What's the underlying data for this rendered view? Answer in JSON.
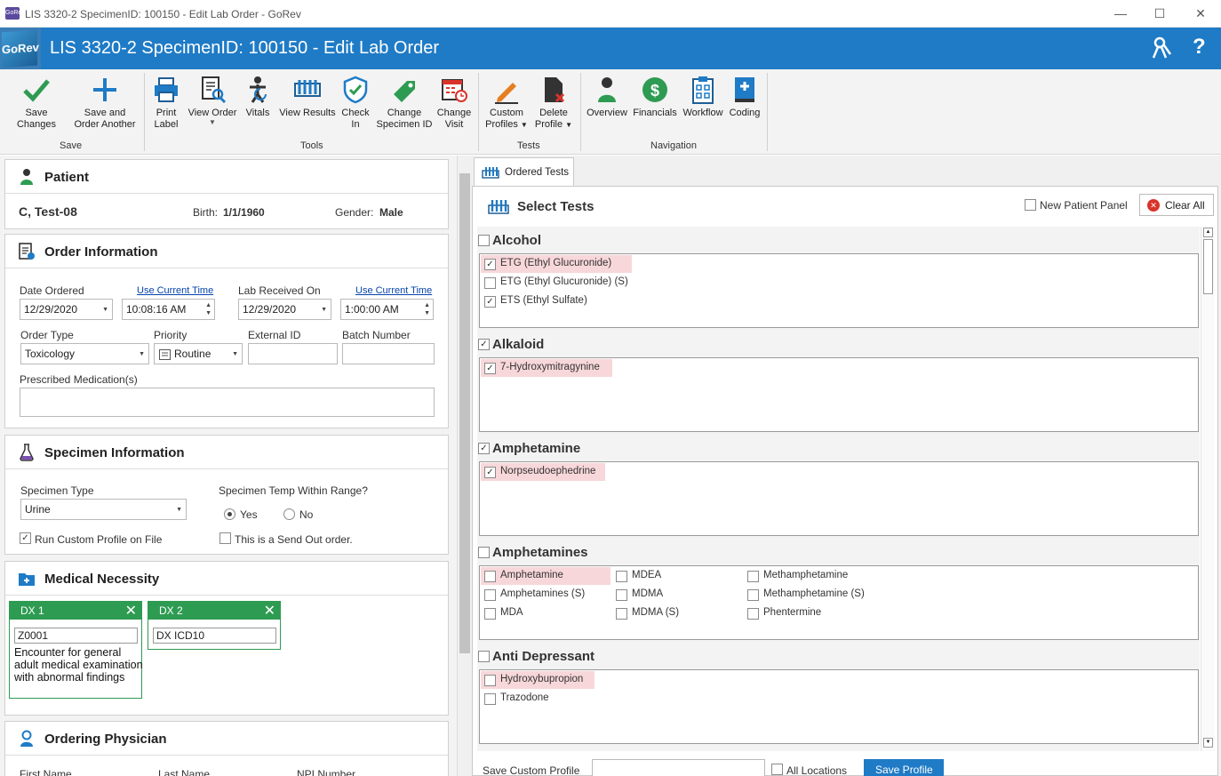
{
  "window": {
    "title": "LIS 3320-2 SpecimenID: 100150 - Edit Lab Order - GoRev",
    "app_icon": "GoRev",
    "minimize": "—",
    "maximize": "☐",
    "close": "✕"
  },
  "header": {
    "title": "LIS 3320-2 SpecimenID: 100150 - Edit Lab Order",
    "logo_text": "GoRev",
    "help_icon": "?"
  },
  "ribbon": {
    "buttons": {
      "save_changes": "Save Changes",
      "save_and_order_line1": "Save and",
      "save_and_order_line2": "Order Another",
      "print_line1": "Print",
      "print_line2": "Label",
      "view_order": "View Order",
      "vitals": "Vitals",
      "view_results": "View Results",
      "check_in_line1": "Check",
      "check_in_line2": "In",
      "change_specimen_line1": "Change",
      "change_specimen_line2": "Specimen ID",
      "change_visit_line1": "Change",
      "change_visit_line2": "Visit",
      "custom_profiles_line1": "Custom",
      "custom_profiles_line2": "Profiles",
      "delete_profile_line1": "Delete",
      "delete_profile_line2": "Profile",
      "overview": "Overview",
      "financials": "Financials",
      "workflow": "Workflow",
      "coding": "Coding"
    },
    "groups": {
      "save": "Save",
      "tools": "Tools",
      "tests": "Tests",
      "navigation": "Navigation"
    }
  },
  "patient": {
    "section_title": "Patient",
    "name": "C, Test-08",
    "birth_label": "Birth:",
    "birth_value": "1/1/1960",
    "gender_label": "Gender:",
    "gender_value": "Male"
  },
  "order_info": {
    "section_title": "Order Information",
    "date_ordered_label": "Date Ordered",
    "use_current_time": "Use Current Time",
    "date_ordered": "12/29/2020",
    "time_ordered": "10:08:16 AM",
    "lab_received_label": "Lab Received On",
    "lab_received_date": "12/29/2020",
    "lab_received_time": "1:00:00 AM",
    "order_type_label": "Order Type",
    "order_type": "Toxicology",
    "priority_label": "Priority",
    "priority": "Routine",
    "external_id_label": "External ID",
    "external_id": "",
    "batch_number_label": "Batch Number",
    "batch_number": "",
    "prescribed_label": "Prescribed Medication(s)",
    "prescribed": ""
  },
  "specimen_info": {
    "section_title": "Specimen Information",
    "type_label": "Specimen Type",
    "type_value": "Urine",
    "temp_label": "Specimen Temp Within Range?",
    "yes": "Yes",
    "no": "No",
    "run_custom_profile": "Run Custom Profile on File",
    "send_out": "This is a Send Out order."
  },
  "medical_necessity": {
    "section_title": "Medical Necessity",
    "dx": [
      {
        "label": "DX 1",
        "code": "Z0001",
        "description": "Encounter for general adult medical examination with abnormal findings"
      },
      {
        "label": "DX 2",
        "code": "DX ICD10",
        "description": ""
      }
    ]
  },
  "ordering_physician": {
    "section_title": "Ordering Physician",
    "first_name": "First Name",
    "last_name": "Last Name",
    "npi": "NPI Number"
  },
  "ordered_tests": {
    "tab_label": "Ordered Tests",
    "select_tests": "Select Tests",
    "new_patient_panel": "New Patient Panel",
    "clear_all": "Clear All",
    "groups": [
      {
        "name": "Alcohol",
        "checked": false,
        "items": [
          {
            "label": "ETG (Ethyl Glucuronide)",
            "checked": true,
            "highlight": true
          },
          {
            "label": "ETG (Ethyl Glucuronide) (S)",
            "checked": false,
            "highlight": false
          },
          {
            "label": "ETS (Ethyl Sulfate)",
            "checked": true,
            "highlight": false
          }
        ]
      },
      {
        "name": "Alkaloid",
        "checked": true,
        "items": [
          {
            "label": "7-Hydroxymitragynine",
            "checked": true,
            "highlight": true
          }
        ]
      },
      {
        "name": "Amphetamine",
        "checked": true,
        "items": [
          {
            "label": "Norpseudoephedrine",
            "checked": true,
            "highlight": true
          }
        ]
      },
      {
        "name": "Amphetamines",
        "checked": false,
        "items": [
          {
            "label": "Amphetamine",
            "checked": false,
            "highlight": true
          },
          {
            "label": "Amphetamines (S)",
            "checked": false,
            "highlight": false
          },
          {
            "label": "MDA",
            "checked": false,
            "highlight": false
          },
          {
            "label": "MDEA",
            "checked": false,
            "highlight": false
          },
          {
            "label": "MDMA",
            "checked": false,
            "highlight": false
          },
          {
            "label": "MDMA (S)",
            "checked": false,
            "highlight": false
          },
          {
            "label": "Methamphetamine",
            "checked": false,
            "highlight": false
          },
          {
            "label": "Methamphetamine (S)",
            "checked": false,
            "highlight": false
          },
          {
            "label": "Phentermine",
            "checked": false,
            "highlight": false
          }
        ]
      },
      {
        "name": "Anti Depressant",
        "checked": false,
        "items": [
          {
            "label": "Hydroxybupropion",
            "checked": false,
            "highlight": true
          },
          {
            "label": "Trazodone",
            "checked": false,
            "highlight": false
          }
        ]
      }
    ],
    "save_custom_profile": "Save Custom Profile",
    "all_locations": "All Locations",
    "save_profile": "Save Profile"
  },
  "colors": {
    "header_blue": "#1f7bc6",
    "ribbon_bg": "#f3f3f3",
    "dx_green": "#2e9b52",
    "highlight_pink": "#f8d7da",
    "clear_red": "#d9342b"
  }
}
